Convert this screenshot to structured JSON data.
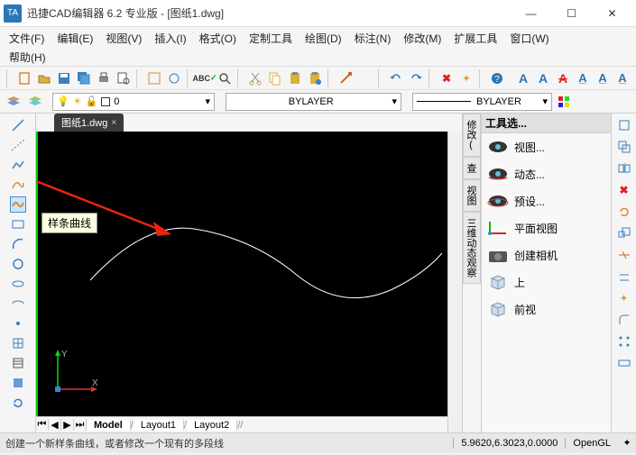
{
  "app": {
    "icon_text": "TA",
    "title": "迅捷CAD编辑器 6.2 专业版  - [图纸1.dwg]"
  },
  "window_buttons": {
    "min": "—",
    "max": "☐",
    "close": "✕"
  },
  "menus": {
    "row1": [
      "文件(F)",
      "编辑(E)",
      "视图(V)",
      "插入(I)",
      "格式(O)",
      "定制工具",
      "绘图(D)",
      "标注(N)",
      "修改(M)",
      "扩展工具",
      "窗口(W)"
    ],
    "row2": [
      "帮助(H)"
    ]
  },
  "toolbar1_colors": {
    "new": "#d98b2e",
    "open": "#d9b13a",
    "save": "#3a7fbf",
    "saveall": "#3a7fbf",
    "print": "#555",
    "preview": "#555",
    "undo": "#d98b2e",
    "redo": "#d98b2e",
    "cut": "#c9a23a",
    "copy": "#d9b13a",
    "paste": "#d9b13a",
    "brush": "#c96a2a",
    "pencil": "#c96a2a",
    "arcU": "#3a7fbf",
    "arcR": "#3a7fbf",
    "xred": "#d22",
    "star": "#d9a63a",
    "help": "#2976b8",
    "A1": "#2976b8",
    "A2": "#2976b8",
    "A3": "#d22",
    "A4": "#2976b8",
    "A5": "#2976b8",
    "A6": "#2976b8"
  },
  "toolbar2": {
    "layer_combo": "0",
    "linetype": "BYLAYER",
    "lineweight": "BYLAYER"
  },
  "doc_tab": {
    "label": "图纸1.dwg",
    "close": "×"
  },
  "tooltip_text": "样条曲线",
  "vtabs": [
    "修改(",
    "查",
    "视图",
    "三维动态观察"
  ],
  "toolpanel": {
    "title": "工具选...",
    "items": [
      {
        "icon": "eye",
        "label": "视图..."
      },
      {
        "icon": "eye-orbit",
        "label": "动态..."
      },
      {
        "icon": "eye-orbit2",
        "label": "预设..."
      },
      {
        "icon": "axes",
        "label": "平面视图"
      },
      {
        "icon": "camera",
        "label": "创建相机"
      },
      {
        "icon": "cube",
        "label": "上"
      },
      {
        "icon": "cube",
        "label": "前视"
      }
    ]
  },
  "layout_tabs": [
    "Model",
    "Layout1",
    "Layout2"
  ],
  "nav_symbols": [
    "⏮",
    "◀",
    "▶",
    "⏭"
  ],
  "status": {
    "text": "创建一个新样条曲线，或者修改一个现有的多段线",
    "coords": "5.9620,6.3023,0.0000",
    "renderer": "OpenGL",
    "corner": "✦"
  },
  "canvas": {
    "y_label": "Y",
    "x_label": "X"
  }
}
